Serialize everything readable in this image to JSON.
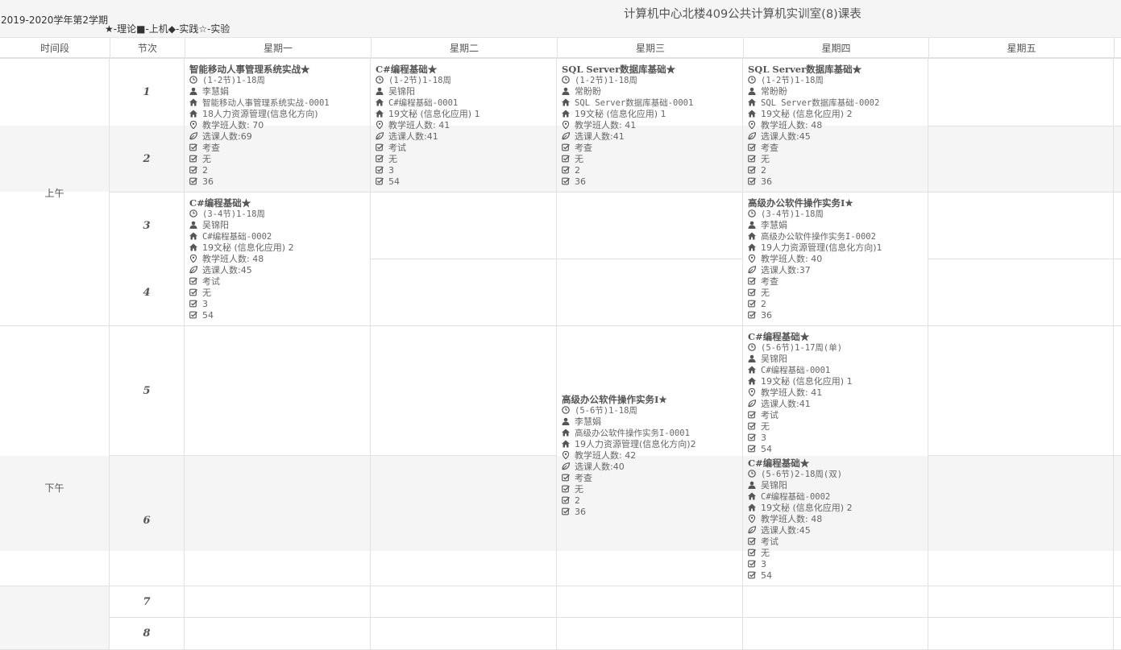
{
  "header": {
    "term": "2019-2020学年第2学期",
    "legend": "★-理论■-上机◆-实践☆-实验",
    "title": "计算机中心北楼409公共计算机实训室(8)课表"
  },
  "columns": {
    "time": "时间段",
    "slot": "节次",
    "days": [
      "星期一",
      "星期二",
      "星期三",
      "星期四",
      "星期五"
    ]
  },
  "periods": {
    "morning": "上午",
    "afternoon": "下午"
  },
  "slots": [
    "1",
    "2",
    "3",
    "4",
    "5",
    "6",
    "7",
    "8"
  ],
  "courses": {
    "mon12": {
      "name": "智能移动人事管理系统实战★",
      "time": "(1-2节)1-18周",
      "teacher": "李慧娟",
      "class": "智能移动人事管理系统实战-0001",
      "group": "18人力资源管理(信息化方向)",
      "size": "教学班人数: 70",
      "enrolled": "选课人数:69",
      "exam": "考查",
      "note": "无",
      "credit": "2",
      "hours": "36"
    },
    "tue12": {
      "name": "C#编程基础★",
      "time": "(1-2节)1-18周",
      "teacher": "吴锦阳",
      "class": "C#编程基础-0001",
      "group": "19文秘 (信息化应用) 1",
      "size": "教学班人数: 41",
      "enrolled": "选课人数:41",
      "exam": "考试",
      "note": "无",
      "credit": "3",
      "hours": "54"
    },
    "wed12": {
      "name": "SQL Server数据库基础★",
      "time": "(1-2节)1-18周",
      "teacher": "常盼盼",
      "class": "SQL Server数据库基础-0001",
      "group": "19文秘 (信息化应用) 1",
      "size": "教学班人数: 41",
      "enrolled": "选课人数:41",
      "exam": "考查",
      "note": "无",
      "credit": "2",
      "hours": "36"
    },
    "thu12": {
      "name": "SQL Server数据库基础★",
      "time": "(1-2节)1-18周",
      "teacher": "常盼盼",
      "class": "SQL Server数据库基础-0002",
      "group": "19文秘 (信息化应用) 2",
      "size": "教学班人数: 48",
      "enrolled": "选课人数:45",
      "exam": "考查",
      "note": "无",
      "credit": "2",
      "hours": "36"
    },
    "mon34": {
      "name": "C#编程基础★",
      "time": "(3-4节)1-18周",
      "teacher": "吴锦阳",
      "class": "C#编程基础-0002",
      "group": "19文秘 (信息化应用) 2",
      "size": "教学班人数: 48",
      "enrolled": "选课人数:45",
      "exam": "考试",
      "note": "无",
      "credit": "3",
      "hours": "54"
    },
    "thu34": {
      "name": "高级办公软件操作实务I★",
      "time": "(3-4节)1-18周",
      "teacher": "李慧娟",
      "class": "高级办公软件操作实务I-0002",
      "group": "19人力资源管理(信息化方向)1",
      "size": "教学班人数: 40",
      "enrolled": "选课人数:37",
      "exam": "考查",
      "note": "无",
      "credit": "2",
      "hours": "36"
    },
    "wed56": {
      "name": "高级办公软件操作实务I★",
      "time": "(5-6节)1-18周",
      "teacher": "李慧娟",
      "class": "高级办公软件操作实务I-0001",
      "group": "19人力资源管理(信息化方向)2",
      "size": "教学班人数: 42",
      "enrolled": "选课人数:40",
      "exam": "考查",
      "note": "无",
      "credit": "2",
      "hours": "36"
    },
    "thu56a": {
      "name": "C#编程基础★",
      "time": "(5-6节)1-17周(单)",
      "teacher": "吴锦阳",
      "class": "C#编程基础-0001",
      "group": "19文秘 (信息化应用) 1",
      "size": "教学班人数: 41",
      "enrolled": "选课人数:41",
      "exam": "考试",
      "note": "无",
      "credit": "3",
      "hours": "54"
    },
    "thu56b": {
      "name": "C#编程基础★",
      "time": "(5-6节)2-18周(双)",
      "teacher": "吴锦阳",
      "class": "C#编程基础-0002",
      "group": "19文秘 (信息化应用) 2",
      "size": "教学班人数: 48",
      "enrolled": "选课人数:45",
      "exam": "考试",
      "note": "无",
      "credit": "3",
      "hours": "54"
    }
  }
}
